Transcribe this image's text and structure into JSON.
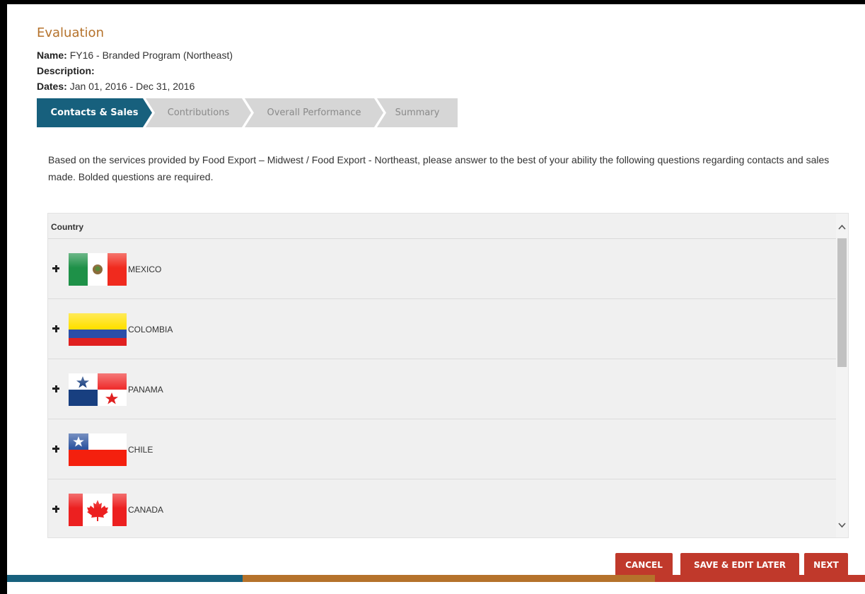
{
  "page": {
    "title": "Evaluation",
    "name_label": "Name:",
    "name_value": "FY16 - Branded Program (Northeast)",
    "description_label": "Description:",
    "dates_label": "Dates:",
    "dates_value": "Jan 01, 2016 - Dec 31, 2016"
  },
  "steps": [
    {
      "label": "Contacts & Sales",
      "active": true
    },
    {
      "label": "Contributions",
      "active": false
    },
    {
      "label": "Overall Performance",
      "active": false
    },
    {
      "label": "Summary",
      "active": false
    }
  ],
  "intro_text": "Based on the services provided by Food Export – Midwest / Food Export - Northeast, please answer to the best of your ability the following questions regarding contacts and sales made. Bolded questions are required.",
  "grid": {
    "column_header": "Country",
    "rows": [
      {
        "country": "MEXICO",
        "flag_icon": "mexico-flag-icon"
      },
      {
        "country": "COLOMBIA",
        "flag_icon": "colombia-flag-icon"
      },
      {
        "country": "PANAMA",
        "flag_icon": "panama-flag-icon"
      },
      {
        "country": "CHILE",
        "flag_icon": "chile-flag-icon"
      },
      {
        "country": "CANADA",
        "flag_icon": "canada-flag-icon"
      }
    ]
  },
  "buttons": {
    "cancel": "CANCEL",
    "save": "SAVE & EDIT LATER",
    "next": "NEXT"
  },
  "colors": {
    "title": "#b5722b",
    "step_active": "#17607d",
    "step_inactive": "#d6d6d6",
    "button": "#c0392b",
    "footer_blue": "#17607d",
    "footer_orange": "#b5722b",
    "footer_red": "#c0392b"
  }
}
